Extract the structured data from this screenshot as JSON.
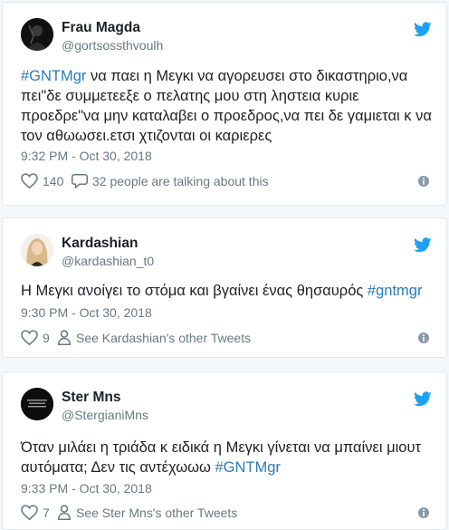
{
  "colors": {
    "link": "#2b7bb9",
    "secondary_text": "#697882",
    "twitter_blue": "#1da1f2",
    "border": "#e1e8ed"
  },
  "tweets": [
    {
      "name": "Frau Magda",
      "handle": "@gortsossthvoulh",
      "text_parts": [
        {
          "type": "hashtag",
          "value": "#GNTMgr"
        },
        {
          "type": "text",
          "value": " να παει η Μεγκι να αγορευσει στο δικαστηριο,να πει\"δε συμμετεεξε ο πελατης μου στη ληστεια κυριε προεδρε\"να μην καταλαβει ο προεδρος,να πει δε γαμιεται κ να τον αθωωσει.ετσι χτιζονται οι καριερες"
        }
      ],
      "time": "9:32 PM - Oct 30, 2018",
      "likes": "140",
      "secondary_action": "32 people are talking about this",
      "secondary_icon": "reply-bubble-icon"
    },
    {
      "name": "Kardashian",
      "handle": "@kardashian_t0",
      "text_parts": [
        {
          "type": "text",
          "value": "Η Μεγκι ανοίγει το στόμα και βγαίνει ένας θησαυρός  "
        },
        {
          "type": "hashtag",
          "value": "#gntmgr"
        }
      ],
      "time": "9:30 PM - Oct 30, 2018",
      "likes": "9",
      "secondary_action": "See Kardashian's other Tweets",
      "secondary_icon": "person-icon"
    },
    {
      "name": "Ster Mns",
      "handle": "@StergianiMns",
      "text_parts": [
        {
          "type": "text",
          "value": "Όταν μιλάει η τριάδα κ ειδικά η Μεγκι γίνεται να μπαίνει μιουτ αυτόματα; Δεν τις αντέχωωω "
        },
        {
          "type": "hashtag",
          "value": "#GNTMgr"
        }
      ],
      "time": "9:33 PM - Oct 30, 2018",
      "likes": "7",
      "secondary_action": "See Ster Mns's other Tweets",
      "secondary_icon": "person-icon"
    }
  ]
}
